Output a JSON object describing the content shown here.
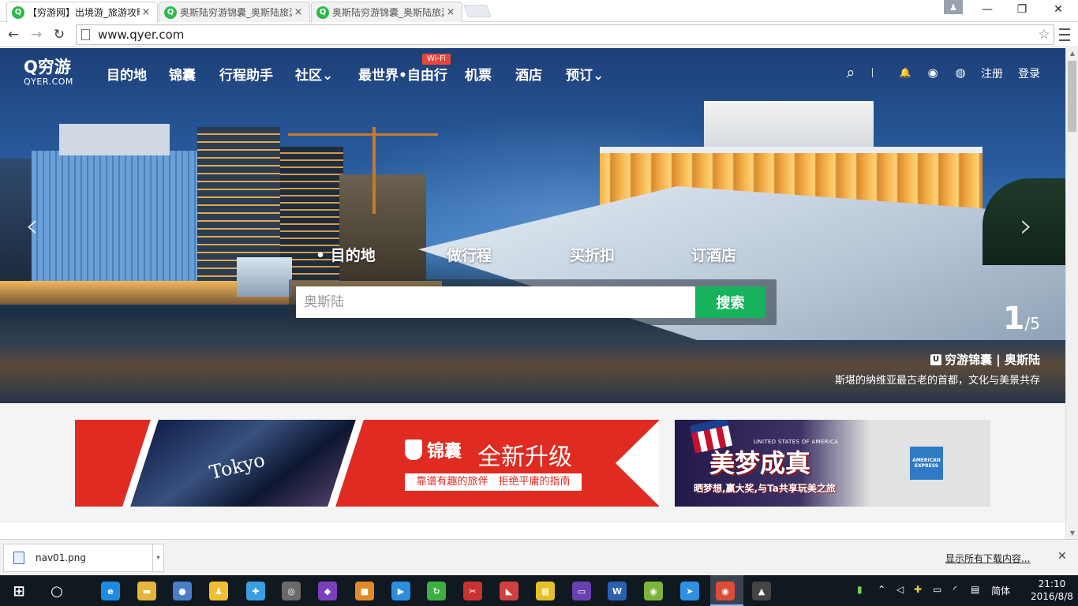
{
  "browser": {
    "tabs": [
      {
        "title": "【穷游网】出境游_旅游攻略",
        "active": true
      },
      {
        "title": "奥斯陆穷游锦囊_奥斯陆旅游",
        "active": false
      },
      {
        "title": "奥斯陆穷游锦囊_奥斯陆旅游",
        "active": false
      }
    ],
    "tab_close": "×",
    "favicon_letter": "Q",
    "url": "www.qyer.com",
    "star": "☆",
    "win_min": "—",
    "win_max": "❐",
    "win_close": "✕",
    "user_icon": "♟",
    "back": "←",
    "forward": "→",
    "reload": "↻"
  },
  "site": {
    "logo_cn": "Q穷游",
    "logo_en": "QYER.COM",
    "nav": [
      {
        "label": "目的地"
      },
      {
        "label": "锦囊"
      },
      {
        "label": "行程助手"
      },
      {
        "label": "社区⌄"
      },
      {
        "label": "最世界•自由行"
      },
      {
        "label": "机票"
      },
      {
        "label": "酒店"
      },
      {
        "label": "预订⌄"
      }
    ],
    "wifi_badge": "Wi-Fi",
    "register": "注册",
    "login": "登录",
    "icons": {
      "search": "⌕",
      "bell": "🔔",
      "weibo": "◉",
      "wechat": "◍"
    }
  },
  "hero": {
    "search_tabs": [
      "• 目的地",
      "做行程",
      "买折扣",
      "订酒店"
    ],
    "search_placeholder": "奥斯陆",
    "search_button": "搜索",
    "slide_current": "1",
    "slide_total": "/5",
    "caption_title": "穷游锦囊 | 奥斯陆",
    "caption_icon": "U",
    "caption_sub": "斯堪的纳维亚最古老的首都，文化与美景共存",
    "arrow_prev": "‹",
    "arrow_next": "›"
  },
  "banners": {
    "left": {
      "tokyo": "Tokyo",
      "brand": "锦囊",
      "headline": "全新升级",
      "tagline": "靠谱有趣的旅伴　拒绝平庸的指南"
    },
    "right": {
      "small": "UNITED STATES OF AMERICA",
      "big": "美梦成真",
      "sub": "晒梦想,赢大奖,与Ta共享玩美之旅",
      "amex": "AMERICAN EXPRESS"
    }
  },
  "download_bar": {
    "file": "nav01.png",
    "caret": "▾",
    "show_all": "显示所有下载内容...",
    "close": "✕"
  },
  "taskbar": {
    "start": "⊞",
    "search": "○",
    "ime": "简体",
    "time": "21:10",
    "date": "2016/8/8",
    "icons": [
      {
        "name": "ie-icon",
        "glyph": "e",
        "color": "#1e8be0"
      },
      {
        "name": "folder-icon",
        "glyph": "▬",
        "color": "#e3b53c"
      },
      {
        "name": "globe-icon",
        "glyph": "●",
        "color": "#4a7dc8"
      },
      {
        "name": "qq-icon",
        "glyph": "♟",
        "color": "#f0c030"
      },
      {
        "name": "network-icon",
        "glyph": "✚",
        "color": "#3a9ee0"
      },
      {
        "name": "disc-icon",
        "glyph": "◎",
        "color": "#6a6a6a"
      },
      {
        "name": "vs-icon",
        "glyph": "◆",
        "color": "#7b3fbd"
      },
      {
        "name": "box-icon",
        "glyph": "■",
        "color": "#e08a2a"
      },
      {
        "name": "player-icon",
        "glyph": "▶",
        "color": "#2b8fe0"
      },
      {
        "name": "refresh-icon",
        "glyph": "↻",
        "color": "#3cb043"
      },
      {
        "name": "tool-icon",
        "glyph": "✂",
        "color": "#c83232"
      },
      {
        "name": "paint-icon",
        "glyph": "◣",
        "color": "#d04040"
      },
      {
        "name": "puzzle-icon",
        "glyph": "▦",
        "color": "#e2c02a"
      },
      {
        "name": "keyboard-icon",
        "glyph": "▭",
        "color": "#6a3fb0"
      },
      {
        "name": "word-icon",
        "glyph": "W",
        "color": "#2b5fb0"
      },
      {
        "name": "android-icon",
        "glyph": "◉",
        "color": "#7bb43a"
      },
      {
        "name": "bird-icon",
        "glyph": "➤",
        "color": "#2f8fe0"
      },
      {
        "name": "chrome-icon",
        "glyph": "◉",
        "color": "#dd4b39"
      },
      {
        "name": "photos-icon",
        "glyph": "▲",
        "color": "#444"
      }
    ]
  }
}
